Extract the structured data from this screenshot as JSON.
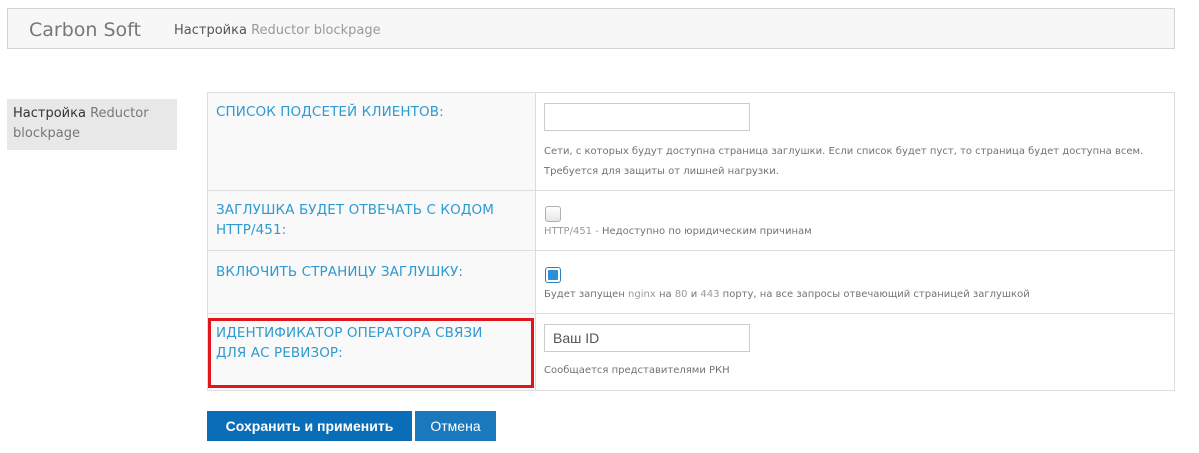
{
  "header": {
    "brand": "Carbon Soft",
    "breadcrumb_section": "Настройка",
    "breadcrumb_page": "Reductor blockpage"
  },
  "sidebar": {
    "items": [
      {
        "label_main": "Настройка",
        "label_rest": "Reductor blockpage"
      }
    ]
  },
  "form": {
    "rows": [
      {
        "label": "СПИСОК ПОДСЕТЕЙ КЛИЕНТОВ:",
        "input_value": "",
        "help_line1": "Сети, с которых будут доступна страница заглушки. Если список будет пуст, то страница будет доступна всем.",
        "help_line2": "Требуется для защиты от лишней нагрузки."
      },
      {
        "label": "ЗАГЛУШКА БУДЕТ ОТВЕЧАТЬ С КОДОМ HTTP/451:",
        "checked": false,
        "help_code": "HTTP/451 -",
        "help_text": " Недоступно по юридическим причинам"
      },
      {
        "label": "ВКЛЮЧИТЬ СТРАНИЦУ ЗАГЛУШКУ:",
        "checked": true,
        "help_p1": "Будет запущен ",
        "help_nginx": "nginx",
        "help_p2": " на ",
        "help_port1": "80",
        "help_p3": " и ",
        "help_port2": "443",
        "help_p4": " порту, на все запросы отвечающий страницей заглушкой"
      },
      {
        "label": "ИДЕНТИФИКАТОР ОПЕРАТОРА СВЯЗИ ДЛЯ АС РЕВИЗОР:",
        "input_value": "Ваш ID",
        "help": "Сообщается представителями РКН"
      }
    ]
  },
  "actions": {
    "save_label": "Сохранить и применить",
    "cancel_label": "Отмена"
  },
  "colors": {
    "label": "#2e9ad0",
    "button": "#0a6db7",
    "highlight": "#e0161c"
  }
}
